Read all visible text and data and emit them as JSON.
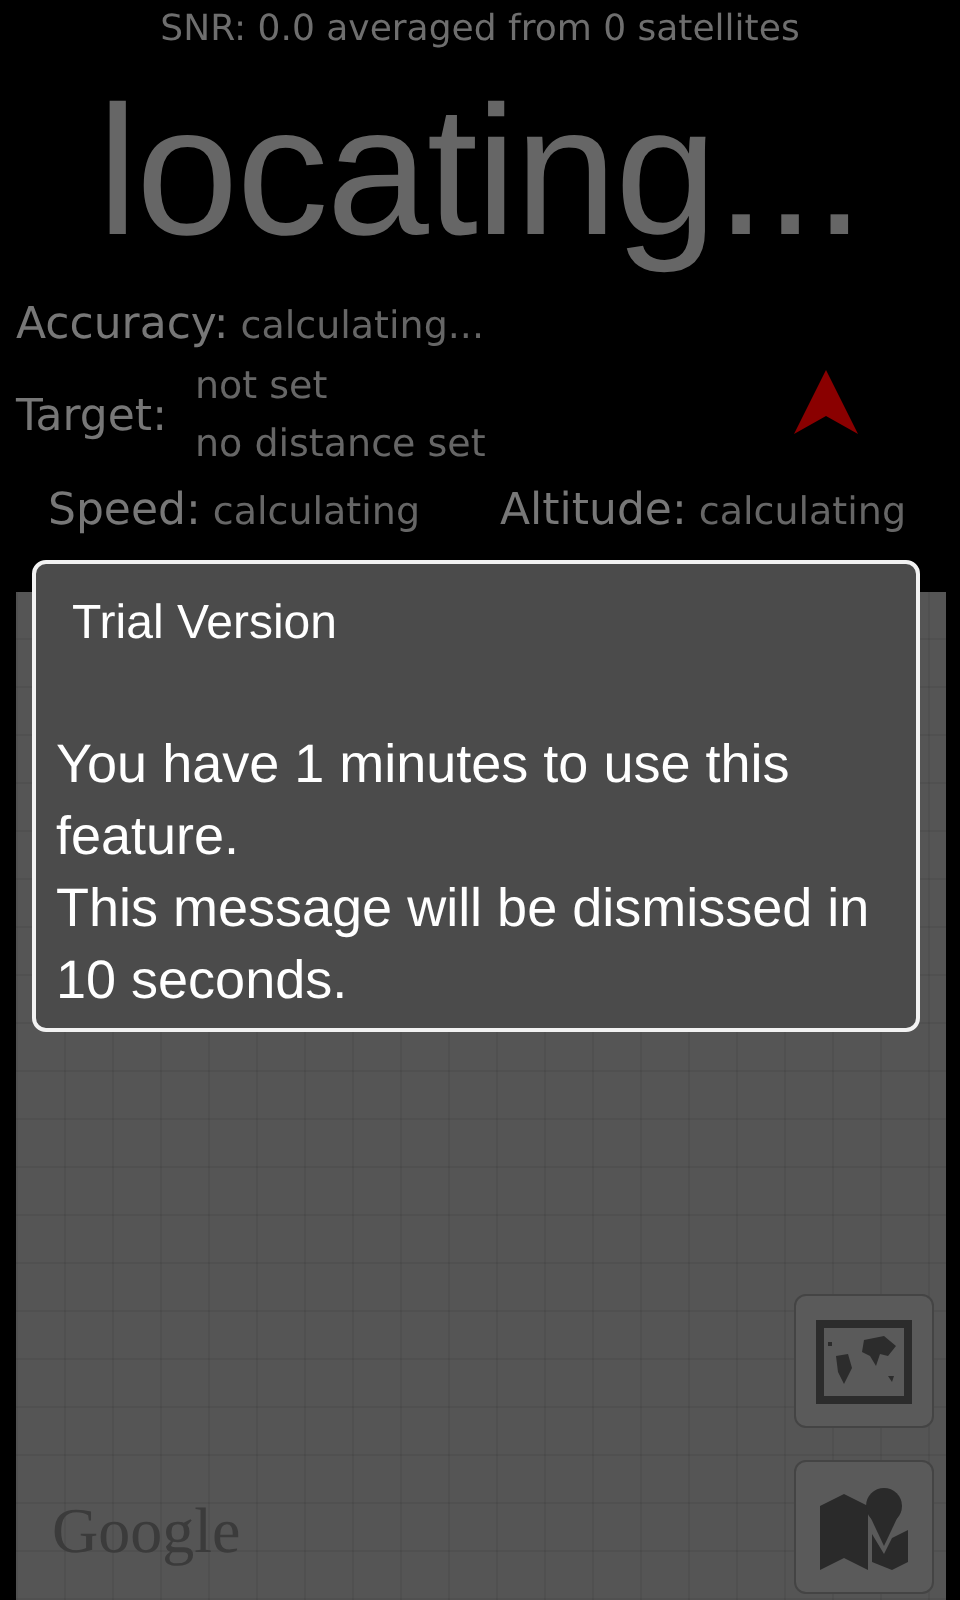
{
  "snr": "SNR: 0.0 averaged from 0 satellites",
  "status": "locating...",
  "accuracy": {
    "label": "Accuracy:",
    "value": "calculating..."
  },
  "target": {
    "label": "Target:",
    "lines": [
      "not set",
      "no distance set"
    ]
  },
  "motion": [
    {
      "label": "Speed:",
      "value": "calculating"
    },
    {
      "label": "Altitude:",
      "value": "calculating"
    }
  ],
  "map": {
    "attribution": "Google"
  },
  "dialog": {
    "title": "Trial Version",
    "paragraphs": [
      "You have 1 minutes to use this feature.",
      "This message will be dismissed in 10 seconds."
    ]
  }
}
